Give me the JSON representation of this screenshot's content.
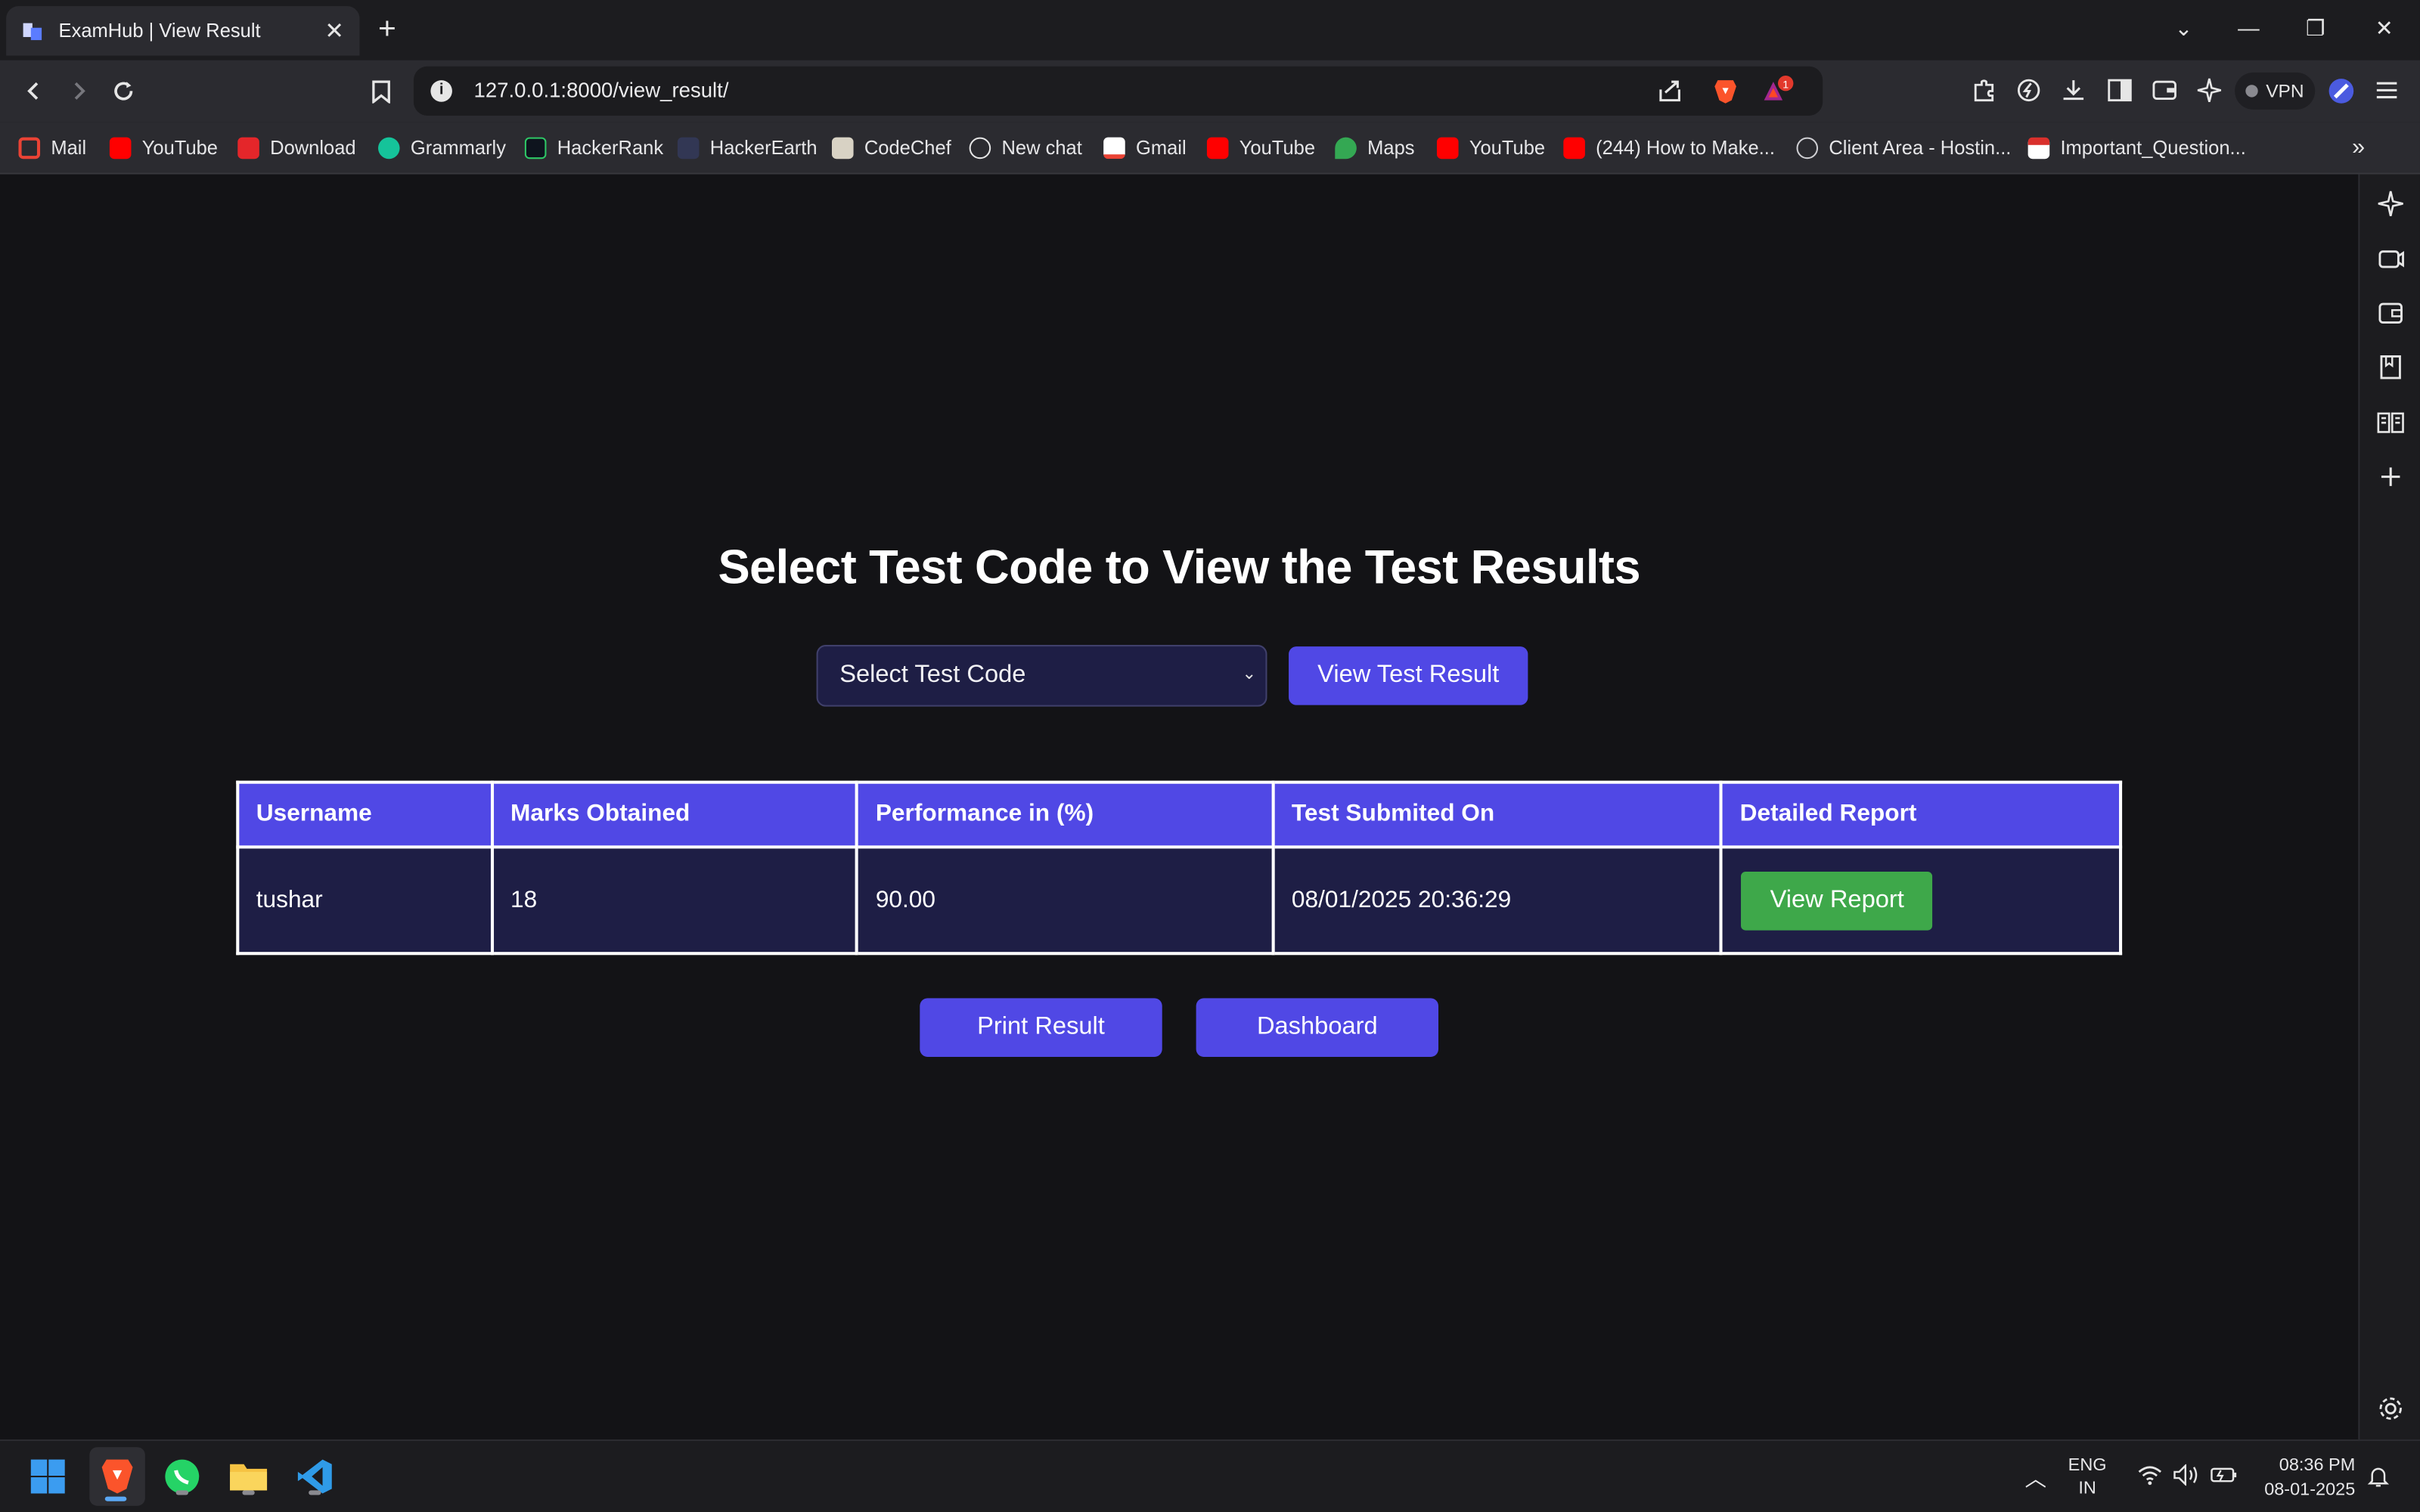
{
  "browser": {
    "tab_title": "ExamHub | View Result",
    "url": "127.0.0.1:8000/view_result/",
    "vpn_label": "VPN",
    "notification_count": "1",
    "bookmarks": [
      {
        "label": "Mail",
        "icon": "gmail-icon"
      },
      {
        "label": "YouTube",
        "icon": "youtube-icon"
      },
      {
        "label": "Download",
        "icon": "download-icon"
      },
      {
        "label": "Grammarly",
        "icon": "grammarly-icon"
      },
      {
        "label": "HackerRank",
        "icon": "hackerrank-icon"
      },
      {
        "label": "HackerEarth",
        "icon": "hackerearth-icon"
      },
      {
        "label": "CodeChef",
        "icon": "codechef-icon"
      },
      {
        "label": "New chat",
        "icon": "chatgpt-icon"
      },
      {
        "label": "Gmail",
        "icon": "gmail-icon"
      },
      {
        "label": "YouTube",
        "icon": "youtube-icon"
      },
      {
        "label": "Maps",
        "icon": "maps-icon"
      },
      {
        "label": "YouTube",
        "icon": "youtube-icon"
      },
      {
        "label": "(244) How to Make...",
        "icon": "youtube-icon"
      },
      {
        "label": "Client Area - Hostin...",
        "icon": "globe-icon"
      },
      {
        "label": "Important_Question...",
        "icon": "pdf-icon"
      }
    ]
  },
  "page": {
    "heading": "Select Test Code to View the Test Results",
    "select_placeholder": "Select Test Code",
    "view_button": "View Test Result",
    "table": {
      "headers": [
        "Username",
        "Marks Obtained",
        "Performance in (%)",
        "Test Submited On",
        "Detailed Report"
      ],
      "rows": [
        {
          "username": "tushar",
          "marks": "18",
          "performance": "90.00",
          "submitted_on": "08/01/2025 20:36:29",
          "report_label": "View Report"
        }
      ]
    },
    "print_button": "Print Result",
    "dashboard_button": "Dashboard"
  },
  "taskbar": {
    "language": "ENG",
    "region": "IN",
    "time": "08:36 PM",
    "date": "08-01-2025"
  },
  "colors": {
    "accent": "#5048e5",
    "report_button": "#3ea84a",
    "table_cell": "#1e1e45",
    "page_background": "#131316"
  }
}
